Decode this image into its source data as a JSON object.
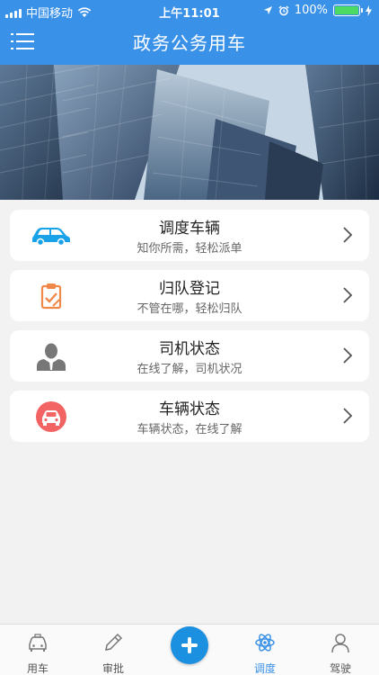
{
  "status_bar": {
    "carrier": "中国移动",
    "time": "上午11:01",
    "battery": "100%",
    "battery_level": 1.0,
    "battery_color": "#4cd964"
  },
  "nav": {
    "title": "政务公务用车",
    "menu_icon": "list-menu-icon",
    "bar_color": "#3a91e8"
  },
  "banner": {
    "image": "skyscrapers-photo"
  },
  "cards": [
    {
      "title": "调度车辆",
      "subtitle": "知你所需，轻松派单",
      "icon": "car-icon",
      "icon_color": "#1aa2e8"
    },
    {
      "title": "归队登记",
      "subtitle": "不管在哪，轻松归队",
      "icon": "clipboard-check-icon",
      "icon_color": "#f0884a"
    },
    {
      "title": "司机状态",
      "subtitle": "在线了解，司机状况",
      "icon": "person-icon",
      "icon_color": "#777777"
    },
    {
      "title": "车辆状态",
      "subtitle": "车辆状态，在线了解",
      "icon": "car-badge-icon",
      "icon_color": "#f26464"
    }
  ],
  "tabbar": {
    "tabs": [
      {
        "label": "用车",
        "icon": "car-tab-icon"
      },
      {
        "label": "审批",
        "icon": "pencil-icon"
      },
      {
        "label": "",
        "icon": "plus-icon"
      },
      {
        "label": "调度",
        "icon": "atom-icon",
        "active": true
      },
      {
        "label": "驾驶",
        "icon": "person-tab-icon"
      }
    ],
    "active_color": "#3a91e8"
  }
}
